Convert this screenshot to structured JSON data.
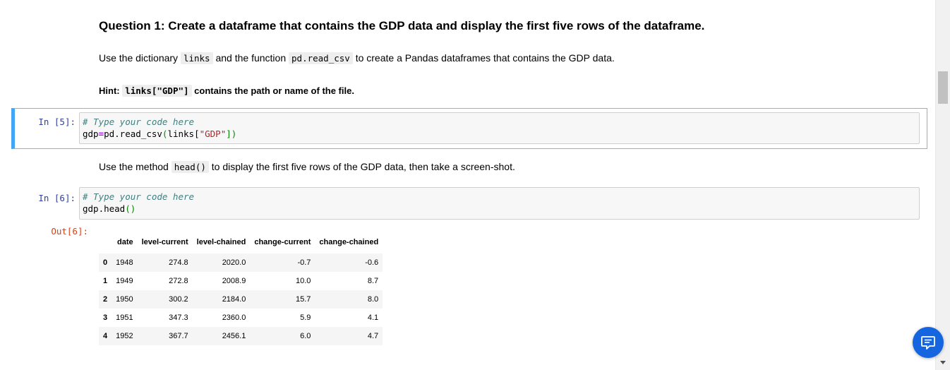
{
  "question": {
    "title": "Question 1: Create a dataframe that contains the GDP data and display the first five rows of the dataframe.",
    "line1_pre": "Use the dictionary ",
    "line1_code1": "links",
    "line1_mid": " and the function ",
    "line1_code2": "pd.read_csv",
    "line1_post": " to create a Pandas dataframes that contains the GDP data.",
    "hint_label": "Hint: ",
    "hint_code": "links[\"GDP\"]",
    "hint_post": " contains the path or name of the file."
  },
  "cell5": {
    "prompt": "In [5]:",
    "comment": "# Type your code here",
    "code_var": "gdp",
    "code_op": "=",
    "code_call": "pd.read_csv",
    "code_open": "(",
    "code_arg": "links[",
    "code_str": "\"GDP\"",
    "code_close": "])"
  },
  "text2": {
    "pre": "Use the method ",
    "code": "head()",
    "post": " to display the first five rows of the GDP data, then take a screen-shot."
  },
  "cell6": {
    "prompt": "In [6]:",
    "comment": "# Type your code here",
    "code_var": "gdp.head",
    "code_paren": "()",
    "out_prompt": "Out[6]:"
  },
  "dataframe": {
    "columns": [
      "",
      "date",
      "level-current",
      "level-chained",
      "change-current",
      "change-chained"
    ],
    "rows": [
      [
        "0",
        "1948",
        "274.8",
        "2020.0",
        "-0.7",
        "-0.6"
      ],
      [
        "1",
        "1949",
        "272.8",
        "2008.9",
        "10.0",
        "8.7"
      ],
      [
        "2",
        "1950",
        "300.2",
        "2184.0",
        "15.7",
        "8.0"
      ],
      [
        "3",
        "1951",
        "347.3",
        "2360.0",
        "5.9",
        "4.1"
      ],
      [
        "4",
        "1952",
        "367.7",
        "2456.1",
        "6.0",
        "4.7"
      ]
    ]
  },
  "icons": {
    "chat": "chat-bubble-icon",
    "scroll_down": "chevron-down-icon"
  },
  "colors": {
    "selected_cell_bar": "#42a5f5",
    "chat_button": "#1565e0",
    "in_prompt": "#303f9f",
    "out_prompt": "#d84315"
  }
}
